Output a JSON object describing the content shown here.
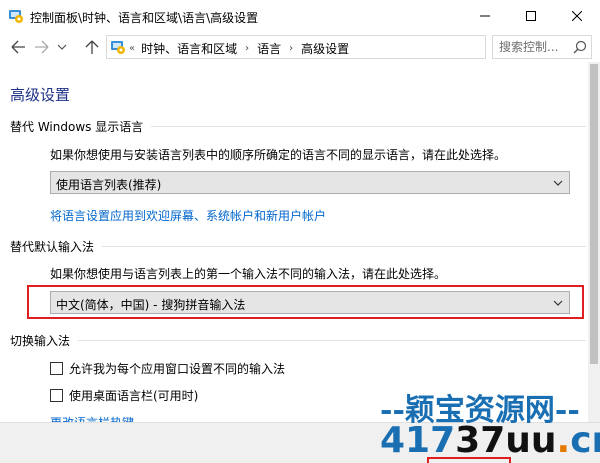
{
  "window": {
    "title": "控制面板\\时钟、语言和区域\\语言\\高级设置",
    "icon": "control-panel-icon",
    "buttons": [
      "minimize-icon",
      "maximize-icon",
      "close-icon"
    ]
  },
  "address": {
    "overflow": "«",
    "crumbs": [
      "时钟、语言和区域",
      "语言",
      "高级设置"
    ],
    "search_placeholder": "搜索控制..."
  },
  "page": {
    "title": "高级设置",
    "display_language": {
      "heading": "替代 Windows 显示语言",
      "description": "如果你想使用与安装语言列表中的顺序所确定的语言不同的显示语言，请在此处选择。",
      "selected": "使用语言列表(推荐)",
      "link": "将语言设置应用到欢迎屏幕、系统帐户和新用户帐户"
    },
    "input_method": {
      "heading": "替代默认输入法",
      "description": "如果你想使用与语言列表上的第一个输入法不同的输入法，请在此处选择。",
      "selected": "中文(简体，中国) - 搜狗拼音输入法"
    },
    "switch_input": {
      "heading": "切换输入法",
      "option1": "允许我为每个应用窗口设置不同的输入法",
      "option2": "使用桌面语言栏(可用时)",
      "link": "更改语言栏热键"
    }
  },
  "watermark": {
    "top": "--颖宝资源网--",
    "num": "417",
    "brand1": "37",
    "brand2": "uu",
    "dot": ".",
    "tld": "cn"
  },
  "colors": {
    "accent": "#1e3287",
    "link": "#0066cc",
    "highlight": "#e02020",
    "watermark_blue": "#1a6fb3",
    "watermark_orange": "#e47a00"
  }
}
